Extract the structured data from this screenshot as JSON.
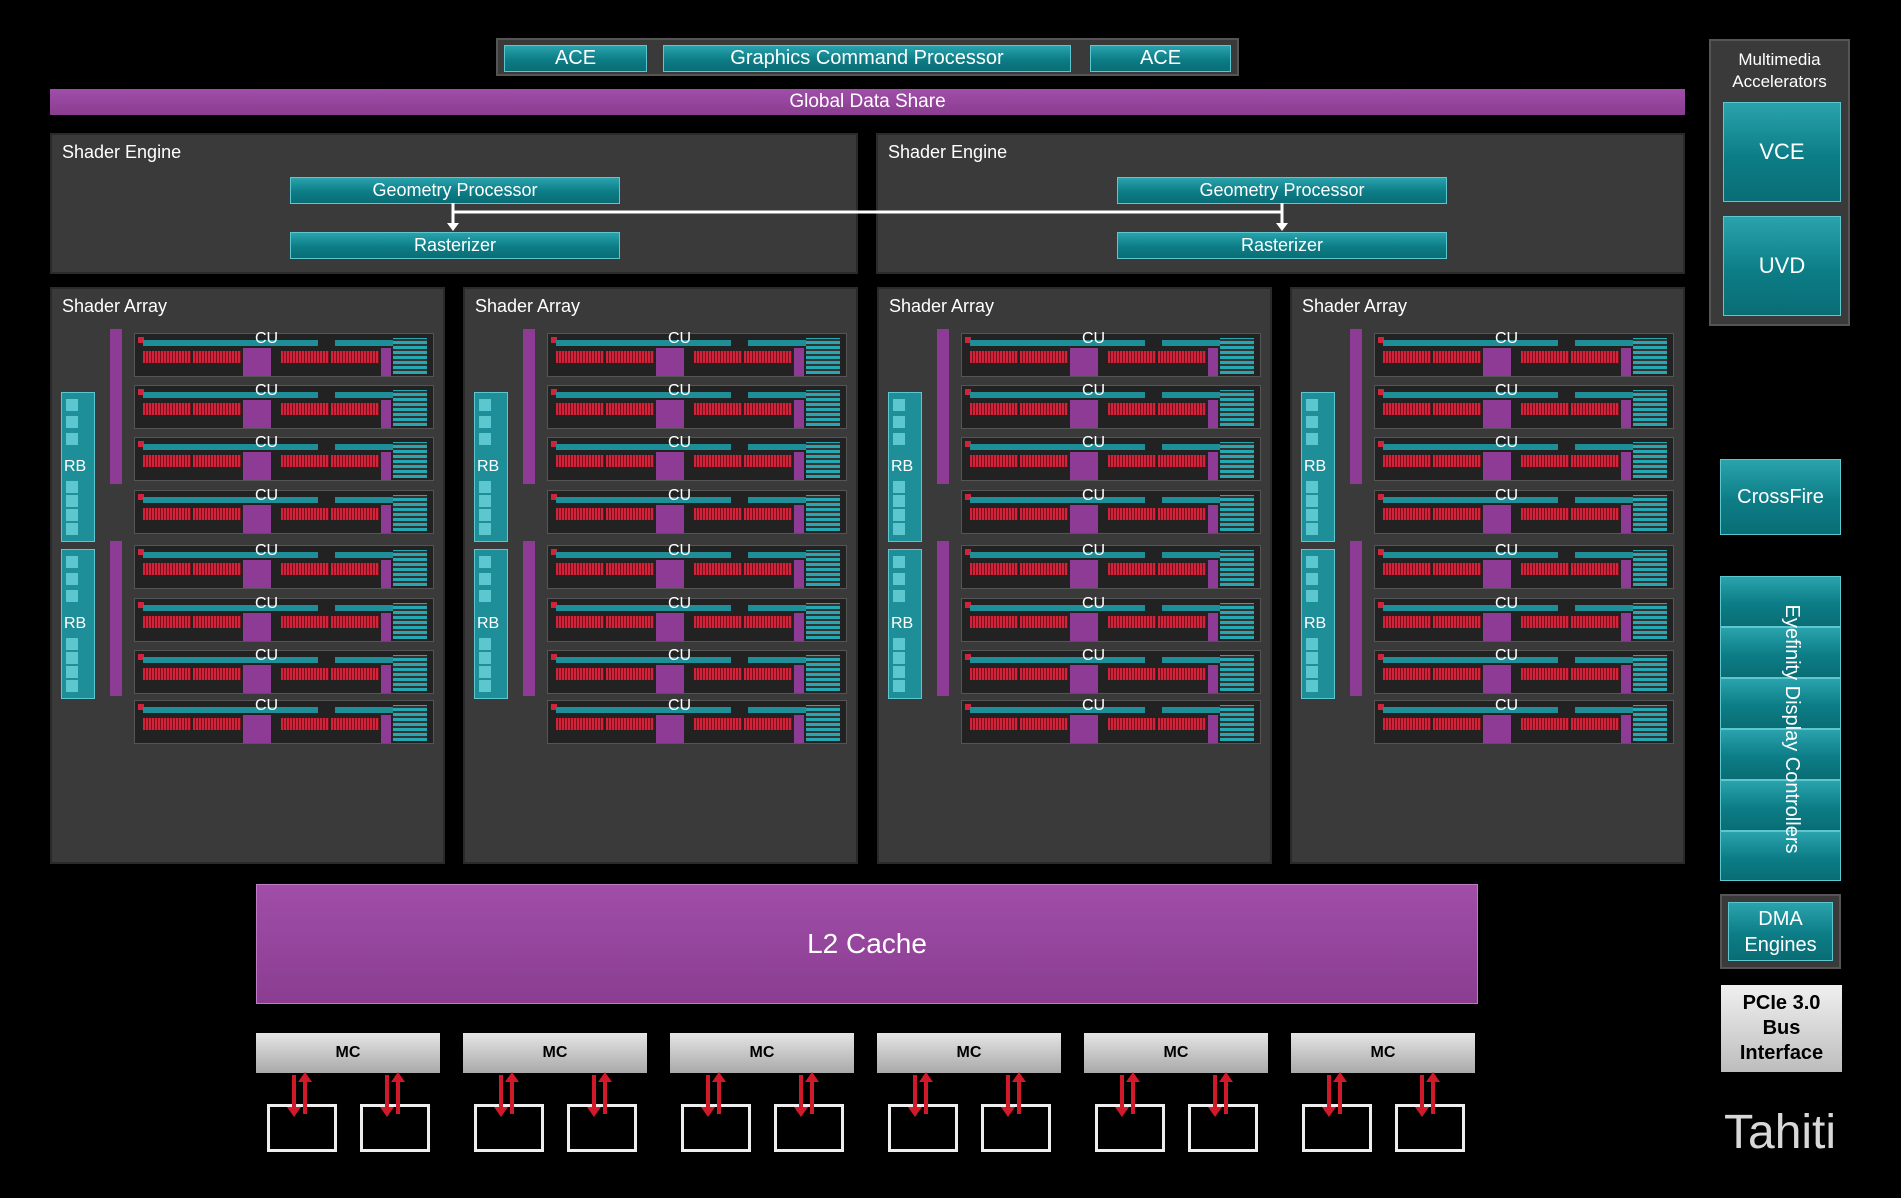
{
  "top_bar": {
    "ace_left": "ACE",
    "gcp": "Graphics Command Processor",
    "ace_right": "ACE"
  },
  "global_data_share": "Global Data Share",
  "shader_engines": [
    {
      "title": "Shader Engine",
      "geometry": "Geometry Processor",
      "rasterizer": "Rasterizer"
    },
    {
      "title": "Shader Engine",
      "geometry": "Geometry Processor",
      "rasterizer": "Rasterizer"
    }
  ],
  "shader_arrays": [
    {
      "title": "Shader Array",
      "cu_label": "CU",
      "rb_label": "RB"
    },
    {
      "title": "Shader Array",
      "cu_label": "CU",
      "rb_label": "RB"
    },
    {
      "title": "Shader Array",
      "cu_label": "CU",
      "rb_label": "RB"
    },
    {
      "title": "Shader Array",
      "cu_label": "CU",
      "rb_label": "RB"
    }
  ],
  "l2_cache": "L2 Cache",
  "mc_label": "MC",
  "right_column": {
    "multimedia": "Multimedia Accelerators",
    "vce": "VCE",
    "uvd": "UVD",
    "crossfire": "CrossFire",
    "eyefinity": "Eyefinity Display Controllers",
    "dma": "DMA Engines",
    "pcie": "PCIe 3.0 Bus Interface"
  },
  "chip_name": "Tahiti",
  "colors": {
    "teal": "#0c7d86",
    "purple": "#8a3d91",
    "red": "#d01a2a",
    "panel": "#3a3a3a"
  }
}
